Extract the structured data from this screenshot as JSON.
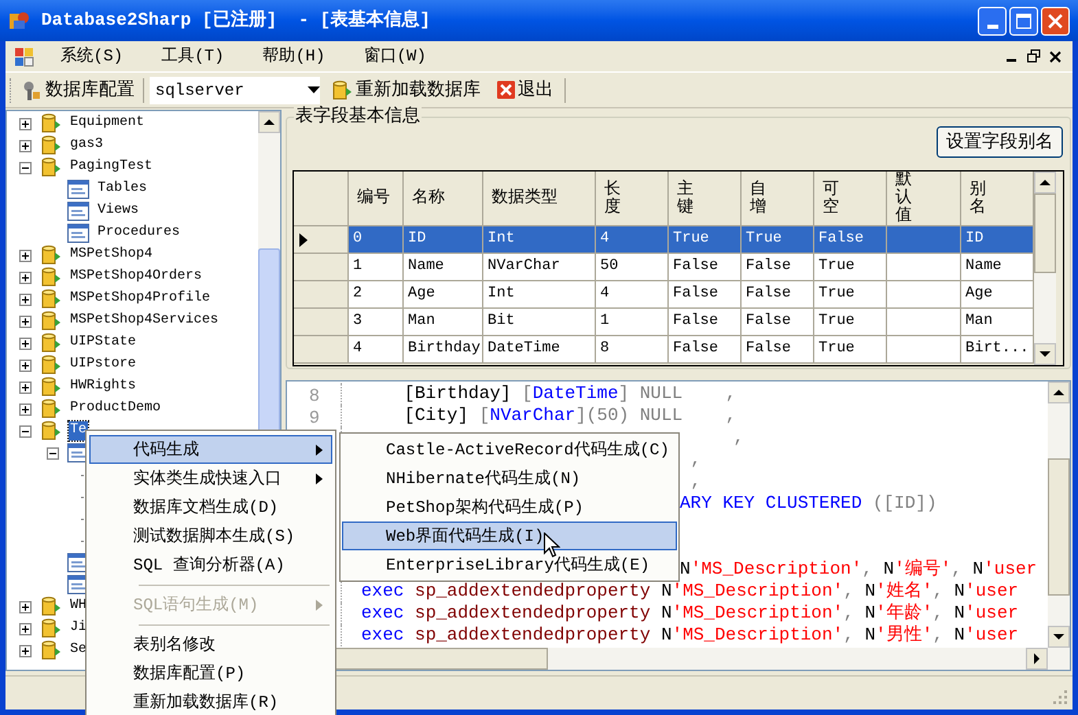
{
  "window": {
    "title": "Database2Sharp [已注册]  - [表基本信息]"
  },
  "menu_bar": [
    "系统(S)",
    "工具(T)",
    "帮助(H)",
    "窗口(W)"
  ],
  "toolbar": {
    "config_button": "数据库配置",
    "server_select": {
      "value": "sqlserver"
    },
    "reload_button": "重新加载数据库",
    "exit_button": "退出"
  },
  "tree": [
    {
      "label": "Equipment",
      "kind": "database",
      "expanded": false
    },
    {
      "label": "gas3",
      "kind": "database",
      "expanded": false
    },
    {
      "label": "PagingTest",
      "kind": "database",
      "expanded": true,
      "children": [
        {
          "label": "Tables",
          "kind": "folder"
        },
        {
          "label": "Views",
          "kind": "folder"
        },
        {
          "label": "Procedures",
          "kind": "folder"
        }
      ]
    },
    {
      "label": "MSPetShop4",
      "kind": "database",
      "expanded": false
    },
    {
      "label": "MSPetShop4Orders",
      "kind": "database",
      "expanded": false
    },
    {
      "label": "MSPetShop4Profile",
      "kind": "database",
      "expanded": false
    },
    {
      "label": "MSPetShop4Services",
      "kind": "database",
      "expanded": false
    },
    {
      "label": "UIPState",
      "kind": "database",
      "expanded": false
    },
    {
      "label": "UIPstore",
      "kind": "database",
      "expanded": false
    },
    {
      "label": "HWRights",
      "kind": "database",
      "expanded": false
    },
    {
      "label": "ProductDemo",
      "kind": "database",
      "expanded": false
    },
    {
      "label": "Te",
      "kind": "database",
      "expanded": true,
      "selected": true,
      "children": [
        {
          "kind": "folder",
          "expanded": true,
          "children": [
            {
              "kind": "leaf"
            },
            {
              "kind": "leaf"
            },
            {
              "kind": "leaf"
            },
            {
              "kind": "leaf"
            }
          ]
        },
        {
          "kind": "folder"
        },
        {
          "kind": "folder"
        }
      ]
    },
    {
      "label": "WH",
      "kind": "database",
      "expanded": false
    },
    {
      "label": "Ji",
      "kind": "database",
      "expanded": false
    },
    {
      "label": "Se",
      "kind": "database",
      "expanded": false
    }
  ],
  "fields_panel": {
    "title": "表字段基本信息",
    "alias_button": "设置字段别名",
    "table": {
      "columns": [
        "编号",
        "名称",
        "数据类型",
        "长度",
        "主键",
        "自增",
        "可空",
        "默认值",
        "别名"
      ],
      "rows": [
        {
          "selected": true,
          "cells": [
            "0",
            "ID",
            "Int",
            "4",
            "True",
            "True",
            "False",
            "",
            "ID"
          ]
        },
        {
          "selected": false,
          "cells": [
            "1",
            "Name",
            "NVarChar",
            "50",
            "False",
            "False",
            "True",
            "",
            "Name"
          ]
        },
        {
          "selected": false,
          "cells": [
            "2",
            "Age",
            "Int",
            "4",
            "False",
            "False",
            "True",
            "",
            "Age"
          ]
        },
        {
          "selected": false,
          "cells": [
            "3",
            "Man",
            "Bit",
            "1",
            "False",
            "False",
            "True",
            "",
            "Man"
          ]
        },
        {
          "selected": false,
          "cells": [
            "4",
            "Birthday",
            "DateTime",
            "8",
            "False",
            "False",
            "True",
            "",
            "Birt..."
          ]
        }
      ]
    }
  },
  "code_editor": {
    "lines": [
      {
        "number": "8",
        "segments": [
          {
            "kind": "plain",
            "text": "    [Birthday] "
          },
          {
            "kind": "punct",
            "text": "["
          },
          {
            "kind": "type",
            "text": "DateTime"
          },
          {
            "kind": "punct",
            "text": "] NULL    ,"
          }
        ]
      },
      {
        "number": "9",
        "segments": [
          {
            "kind": "plain",
            "text": "    [City] "
          },
          {
            "kind": "punct",
            "text": "["
          },
          {
            "kind": "type",
            "text": "NVarChar"
          },
          {
            "kind": "punct",
            "text": "](50) NULL    ,"
          }
        ]
      },
      {
        "partly_hidden": true,
        "segments": [
          {
            "kind": "punct",
            "text": "     ,"
          }
        ]
      },
      {
        "partly_hidden": true,
        "segments": [
          {
            "kind": "punct",
            "text": " ,"
          }
        ]
      },
      {
        "partly_hidden": true,
        "segments": [
          {
            "kind": "punct",
            "text": " ,"
          }
        ]
      },
      {
        "partly_hidden": true,
        "segments": [
          {
            "kind": "keyword",
            "text": "ARY KEY CLUSTERED "
          },
          {
            "kind": "punct",
            "text": "([ID])"
          }
        ]
      }
    ],
    "lines_below_menu": [
      {
        "partly_hidden": true,
        "segments": [
          {
            "kind": "plain",
            "text": "N"
          },
          {
            "kind": "string",
            "text": "'MS_Description'"
          },
          {
            "kind": "punct",
            "text": ", "
          },
          {
            "kind": "plain",
            "text": "N"
          },
          {
            "kind": "string",
            "text": "'编号'"
          },
          {
            "kind": "punct",
            "text": ", "
          },
          {
            "kind": "plain",
            "text": "N"
          },
          {
            "kind": "string",
            "text": "'user"
          }
        ]
      },
      {
        "partly_hidden": false,
        "segments": [
          {
            "kind": "keyword",
            "text": "exec "
          },
          {
            "kind": "proc",
            "text": "sp_addextendedproperty "
          },
          {
            "kind": "plain",
            "text": "N"
          },
          {
            "kind": "string",
            "text": "'MS_Description'"
          },
          {
            "kind": "punct",
            "text": ", "
          },
          {
            "kind": "plain",
            "text": "N"
          },
          {
            "kind": "string",
            "text": "'姓名'"
          },
          {
            "kind": "punct",
            "text": ", "
          },
          {
            "kind": "plain",
            "text": "N"
          },
          {
            "kind": "string",
            "text": "'user"
          }
        ]
      },
      {
        "partly_hidden": false,
        "segments": [
          {
            "kind": "keyword",
            "text": "exec "
          },
          {
            "kind": "proc",
            "text": "sp_addextendedproperty "
          },
          {
            "kind": "plain",
            "text": "N"
          },
          {
            "kind": "string",
            "text": "'MS_Description'"
          },
          {
            "kind": "punct",
            "text": ", "
          },
          {
            "kind": "plain",
            "text": "N"
          },
          {
            "kind": "string",
            "text": "'年龄'"
          },
          {
            "kind": "punct",
            "text": ", "
          },
          {
            "kind": "plain",
            "text": "N"
          },
          {
            "kind": "string",
            "text": "'user"
          }
        ]
      },
      {
        "partly_hidden": false,
        "segments": [
          {
            "kind": "keyword",
            "text": "exec "
          },
          {
            "kind": "proc",
            "text": "sp_addextendedproperty "
          },
          {
            "kind": "plain",
            "text": "N"
          },
          {
            "kind": "string",
            "text": "'MS_Description'"
          },
          {
            "kind": "punct",
            "text": ", "
          },
          {
            "kind": "plain",
            "text": "N"
          },
          {
            "kind": "string",
            "text": "'男性'"
          },
          {
            "kind": "punct",
            "text": ", "
          },
          {
            "kind": "plain",
            "text": "N"
          },
          {
            "kind": "string",
            "text": "'user"
          }
        ]
      }
    ]
  },
  "context_menu": {
    "items": [
      {
        "kind": "item",
        "label": "代码生成",
        "submenu": true,
        "selected": true,
        "disabled": false
      },
      {
        "kind": "item",
        "label": "实体类生成快速入口",
        "submenu": true,
        "selected": false,
        "disabled": false
      },
      {
        "kind": "item",
        "label": "数据库文档生成(D)",
        "submenu": false,
        "selected": false,
        "disabled": false
      },
      {
        "kind": "item",
        "label": "测试数据脚本生成(S)",
        "submenu": false,
        "selected": false,
        "disabled": false
      },
      {
        "kind": "item",
        "label": "SQL 查询分析器(A)",
        "submenu": false,
        "selected": false,
        "disabled": false
      },
      {
        "kind": "separator"
      },
      {
        "kind": "item",
        "label": "SQL语句生成(M)",
        "submenu": true,
        "selected": false,
        "disabled": true
      },
      {
        "kind": "separator"
      },
      {
        "kind": "item",
        "label": "表别名修改",
        "submenu": false,
        "selected": false,
        "disabled": false
      },
      {
        "kind": "item",
        "label": "数据库配置(P)",
        "submenu": false,
        "selected": false,
        "disabled": false
      },
      {
        "kind": "item",
        "label": "重新加载数据库(R)",
        "submenu": false,
        "selected": false,
        "disabled": false
      }
    ]
  },
  "submenu": {
    "items": [
      {
        "label": "Castle-ActiveRecord代码生成(C)",
        "selected": false
      },
      {
        "label": "NHibernate代码生成(N)",
        "selected": false
      },
      {
        "label": "PetShop架构代码生成(P)",
        "selected": false
      },
      {
        "label": "Web界面代码生成(I)",
        "selected": true
      },
      {
        "label": "EnterpriseLibrary代码生成(E)",
        "selected": false
      }
    ]
  }
}
